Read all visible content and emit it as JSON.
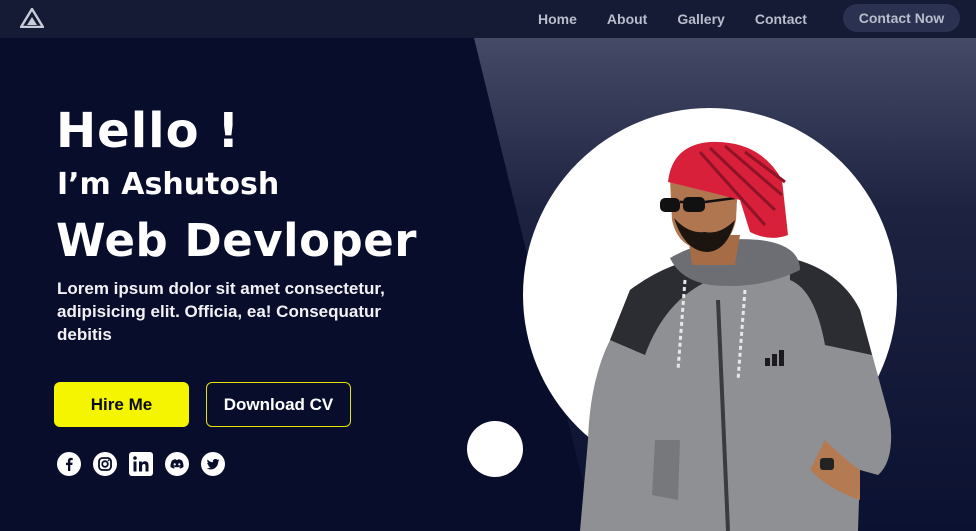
{
  "nav": {
    "links": [
      "Home",
      "About",
      "Gallery",
      "Contact"
    ],
    "cta": "Contact Now"
  },
  "hero": {
    "greeting": "Hello !",
    "intro": "I’m Ashutosh",
    "role": "Web Devloper",
    "description": "Lorem ipsum dolor sit amet consectetur, adipisicing elit. Officia, ea! Consequatur debitis",
    "primary_button": "Hire Me",
    "secondary_button": "Download CV"
  },
  "socials": [
    "facebook-icon",
    "instagram-icon",
    "linkedin-icon",
    "discord-icon",
    "twitter-icon"
  ],
  "colors": {
    "background": "#070d2a",
    "nav": "#151a35",
    "accent": "#f5f500",
    "text": "#ffffff"
  }
}
